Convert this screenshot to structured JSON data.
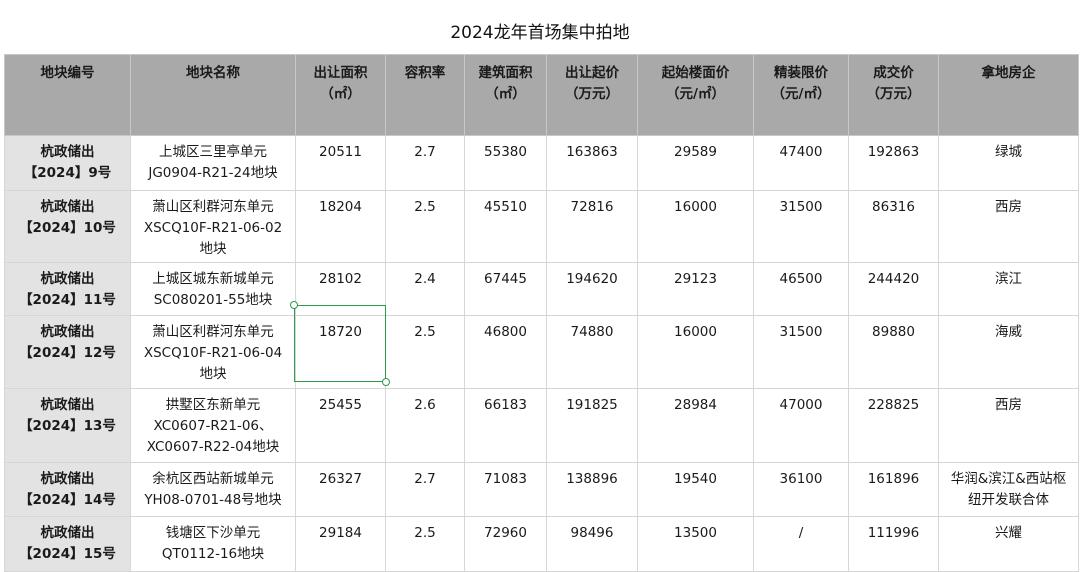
{
  "title": "2024龙年首场集中拍地",
  "headers": [
    [
      "地块编号"
    ],
    [
      "地块名称"
    ],
    [
      "出让面积",
      "（㎡）"
    ],
    [
      "容积率"
    ],
    [
      "建筑面积",
      "（㎡）"
    ],
    [
      "出让起价",
      "（万元）"
    ],
    [
      "起始楼面价",
      "（元/㎡）"
    ],
    [
      "精装限价",
      "（元/㎡）"
    ],
    [
      "成交价",
      "（万元）"
    ],
    [
      "拿地房企"
    ]
  ],
  "rows": [
    {
      "code": "杭政储出\n【2024】9号",
      "name": "上城区三里亭单元\nJG0904-R21-24地块",
      "area": "20511",
      "far": "2.7",
      "build_area": "55380",
      "start_price": "163863",
      "floor_price": "29589",
      "cap_price": "47400",
      "deal_price": "192863",
      "buyer": "绿城"
    },
    {
      "code": "杭政储出\n【2024】10号",
      "name": "萧山区利群河东单元\nXSCQ10F-R21-06-02\n地块",
      "area": "18204",
      "far": "2.5",
      "build_area": "45510",
      "start_price": "72816",
      "floor_price": "16000",
      "cap_price": "31500",
      "deal_price": "86316",
      "buyer": "西房"
    },
    {
      "code": "杭政储出\n【2024】11号",
      "name": "上城区城东新城单元\nSC080201-55地块",
      "area": "28102",
      "far": "2.4",
      "build_area": "67445",
      "start_price": "194620",
      "floor_price": "29123",
      "cap_price": "46500",
      "deal_price": "244420",
      "buyer": "滨江"
    },
    {
      "code": "杭政储出\n【2024】12号",
      "name": "萧山区利群河东单元\nXSCQ10F-R21-06-04\n地块",
      "area": "18720",
      "far": "2.5",
      "build_area": "46800",
      "start_price": "74880",
      "floor_price": "16000",
      "cap_price": "31500",
      "deal_price": "89880",
      "buyer": "海威"
    },
    {
      "code": "杭政储出\n【2024】13号",
      "name": "拱墅区东新单元\nXC0607-R21-06、\nXC0607-R22-04地块",
      "area": "25455",
      "far": "2.6",
      "build_area": "66183",
      "start_price": "191825",
      "floor_price": "28984",
      "cap_price": "47000",
      "deal_price": "228825",
      "buyer": "西房"
    },
    {
      "code": "杭政储出\n【2024】14号",
      "name": "余杭区西站新城单元\nYH08-0701-48号地块",
      "area": "26327",
      "far": "2.7",
      "build_area": "71083",
      "start_price": "138896",
      "floor_price": "19540",
      "cap_price": "36100",
      "deal_price": "161896",
      "buyer": "华润&滨江&西站枢\n纽开发联合体"
    },
    {
      "code": "杭政储出\n【2024】15号",
      "name": "钱塘区下沙单元\nQT0112-16地块",
      "area": "29184",
      "far": "2.5",
      "build_area": "72960",
      "start_price": "98496",
      "floor_price": "13500",
      "cap_price": "/",
      "deal_price": "111996",
      "buyer": "兴耀"
    }
  ]
}
